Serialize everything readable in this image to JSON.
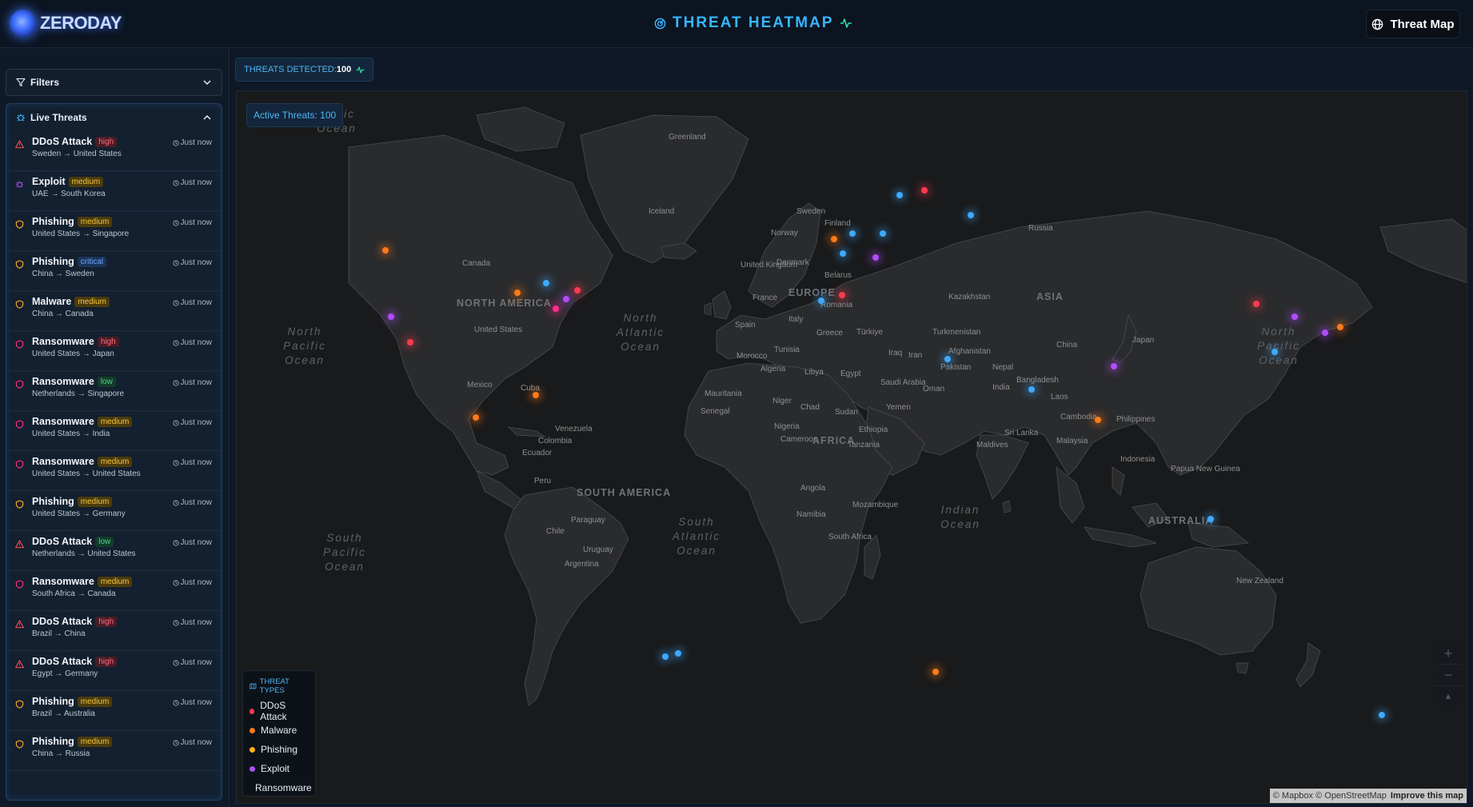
{
  "header": {
    "logo_text": "ZERODAY",
    "title": "THREAT HEATMAP",
    "threat_map_button": "Threat Map"
  },
  "sidebar": {
    "filters_label": "Filters",
    "live_threats_label": "Live Threats",
    "threats": [
      {
        "type": "DDoS Attack",
        "severity": "high",
        "route": "Sweden → United States",
        "time": "Just now",
        "icon": "warning-triangle-icon"
      },
      {
        "type": "Exploit",
        "severity": "medium",
        "route": "UAE → South Korea",
        "time": "Just now",
        "icon": "bug-icon"
      },
      {
        "type": "Phishing",
        "severity": "medium",
        "route": "United States → Singapore",
        "time": "Just now",
        "icon": "shield-icon"
      },
      {
        "type": "Phishing",
        "severity": "critical",
        "route": "China → Sweden",
        "time": "Just now",
        "icon": "shield-icon"
      },
      {
        "type": "Malware",
        "severity": "medium",
        "route": "China → Canada",
        "time": "Just now",
        "icon": "shield-icon"
      },
      {
        "type": "Ransomware",
        "severity": "high",
        "route": "United States → Japan",
        "time": "Just now",
        "icon": "shield-icon"
      },
      {
        "type": "Ransomware",
        "severity": "low",
        "route": "Netherlands → Singapore",
        "time": "Just now",
        "icon": "shield-icon"
      },
      {
        "type": "Ransomware",
        "severity": "medium",
        "route": "United States → India",
        "time": "Just now",
        "icon": "shield-icon"
      },
      {
        "type": "Ransomware",
        "severity": "medium",
        "route": "United States → United States",
        "time": "Just now",
        "icon": "shield-icon"
      },
      {
        "type": "Phishing",
        "severity": "medium",
        "route": "United States → Germany",
        "time": "Just now",
        "icon": "shield-icon"
      },
      {
        "type": "DDoS Attack",
        "severity": "low",
        "route": "Netherlands → United States",
        "time": "Just now",
        "icon": "warning-triangle-icon"
      },
      {
        "type": "Ransomware",
        "severity": "medium",
        "route": "South Africa → Canada",
        "time": "Just now",
        "icon": "shield-icon"
      },
      {
        "type": "DDoS Attack",
        "severity": "high",
        "route": "Brazil → China",
        "time": "Just now",
        "icon": "warning-triangle-icon"
      },
      {
        "type": "DDoS Attack",
        "severity": "high",
        "route": "Egypt → Germany",
        "time": "Just now",
        "icon": "warning-triangle-icon"
      },
      {
        "type": "Phishing",
        "severity": "medium",
        "route": "Brazil → Australia",
        "time": "Just now",
        "icon": "shield-icon"
      },
      {
        "type": "Phishing",
        "severity": "medium",
        "route": "China → Russia",
        "time": "Just now",
        "icon": "shield-icon"
      }
    ]
  },
  "main": {
    "threats_detected_label": "THREATS DETECTED:",
    "threats_detected_count": "100",
    "active_threats": "Active Threats: 100",
    "legend_title": "THREAT TYPES",
    "legend": [
      {
        "label": "DDoS Attack",
        "color": "#ff3b4e"
      },
      {
        "label": "Malware",
        "color": "#ff7a1a"
      },
      {
        "label": "Phishing",
        "color": "#ffb020"
      },
      {
        "label": "Exploit",
        "color": "#b14dff"
      },
      {
        "label": "Ransomware",
        "color": "#ff2d8f"
      }
    ],
    "zoom_in": "+",
    "zoom_out": "−",
    "compass": "▲",
    "attribution": "© Mapbox © OpenStreetMap",
    "improve_link": "Improve this map"
  },
  "map_labels": {
    "greenland": "Greenland",
    "iceland": "Iceland",
    "sweden": "Sweden",
    "finland": "Finland",
    "norway": "Norway",
    "russia": "Russia",
    "canada": "Canada",
    "united_kingdom": "United Kingdom",
    "denmark": "Denmark",
    "belarus": "Belarus",
    "europe": "EUROPE",
    "france": "France",
    "romania": "Romania",
    "spain": "Spain",
    "italy": "Italy",
    "greece": "Greece",
    "turkiye": "Türkiye",
    "kazakhstan": "Kazakhstan",
    "asia": "ASIA",
    "north_america": "NORTH AMERICA",
    "united_states": "United States",
    "turkmenistan": "Turkmenistan",
    "china": "China",
    "japan": "Japan",
    "tunisia": "Tunisia",
    "morocco": "Morocco",
    "algeria": "Algeria",
    "libya": "Libya",
    "egypt": "Egypt",
    "iraq": "Iraq",
    "iran": "Iran",
    "afghanistan": "Afghanistan",
    "pakistan": "Pakistan",
    "nepal": "Nepal",
    "bangladesh": "Bangladesh",
    "india": "India",
    "saudi_arabia": "Saudi Arabia",
    "oman": "Oman",
    "yemen": "Yemen",
    "mexico": "Mexico",
    "cuba": "Cuba",
    "mauritania": "Mauritania",
    "niger": "Niger",
    "chad": "Chad",
    "sudan": "Sudan",
    "senegal": "Senegal",
    "nigeria": "Nigeria",
    "ethiopia": "Ethiopia",
    "laos": "Laos",
    "philippines": "Philippines",
    "cambodia": "Cambodia",
    "venezuela": "Venezuela",
    "colombia": "Colombia",
    "ecuador": "Ecuador",
    "cameroon": "Cameroon",
    "africa": "AFRICA",
    "sri_lanka": "Sri Lanka",
    "maldives": "Maldives",
    "malaysia": "Malaysia",
    "indonesia": "Indonesia",
    "papua_new_guinea": "Papua New Guinea",
    "south_america": "SOUTH AMERICA",
    "peru": "Peru",
    "tanzania": "Tanzania",
    "angola": "Angola",
    "mozambique": "Mozambique",
    "paraguay": "Paraguay",
    "chile": "Chile",
    "namibia": "Namibia",
    "uruguay": "Uruguay",
    "south_africa": "South Africa",
    "argentina": "Argentina",
    "australia": "AUSTRALIA",
    "new_zealand": "New Zealand",
    "north_pacific": "North Pacific Ocean",
    "north_atlantic": "North Atlantic Ocean",
    "south_pacific": "South Pacific Ocean",
    "south_atlantic": "South Atlantic Ocean",
    "indian_ocean": "Indian Ocean",
    "arctic": "Arctic Ocean",
    "north_pacific_right": "North Pacific Ocean"
  },
  "threat_points": [
    {
      "lat": 49.5,
      "lon": -124,
      "type": "Malware"
    },
    {
      "lat": 37.5,
      "lon": -122.5,
      "type": "Exploit"
    },
    {
      "lat": 33,
      "lon": -117,
      "type": "DDoS Attack"
    },
    {
      "lat": 19.5,
      "lon": -99,
      "type": "Malware"
    },
    {
      "lat": 41.8,
      "lon": -87.6,
      "type": "Malware"
    },
    {
      "lat": 43.5,
      "lon": -79.5,
      "type": "Phishing"
    },
    {
      "lat": 38.9,
      "lon": -77,
      "type": "Ransomware"
    },
    {
      "lat": 40.7,
      "lon": -74,
      "type": "Exploit"
    },
    {
      "lat": 42.3,
      "lon": -71,
      "type": "DDoS Attack"
    },
    {
      "lat": 23.5,
      "lon": -82.5,
      "type": "Malware"
    },
    {
      "lat": -22.9,
      "lon": -43.2,
      "type": "Phishing"
    },
    {
      "lat": -23.5,
      "lon": -46.6,
      "type": "Phishing"
    },
    {
      "lat": 51.5,
      "lon": -0.1,
      "type": "Malware"
    },
    {
      "lat": 52.4,
      "lon": 4.9,
      "type": "Phishing"
    },
    {
      "lat": 52.5,
      "lon": 13.4,
      "type": "Phishing"
    },
    {
      "lat": 48.8,
      "lon": 2.4,
      "type": "Phishing"
    },
    {
      "lat": 48.2,
      "lon": 11.5,
      "type": "Exploit"
    },
    {
      "lat": 40.4,
      "lon": -3.7,
      "type": "Phishing"
    },
    {
      "lat": 41.4,
      "lon": 2.2,
      "type": "DDoS Attack"
    },
    {
      "lat": 59.3,
      "lon": 18.1,
      "type": "Phishing"
    },
    {
      "lat": 60.2,
      "lon": 24.9,
      "type": "DDoS Attack"
    },
    {
      "lat": 55.8,
      "lon": 37.6,
      "type": "Phishing"
    },
    {
      "lat": 30.0,
      "lon": 31.2,
      "type": "Phishing"
    },
    {
      "lat": 24.5,
      "lon": 54.4,
      "type": "Phishing"
    },
    {
      "lat": 19.0,
      "lon": 72.8,
      "type": "Malware"
    },
    {
      "lat": 28.6,
      "lon": 77.2,
      "type": "Exploit"
    },
    {
      "lat": 39.9,
      "lon": 116.4,
      "type": "DDoS Attack"
    },
    {
      "lat": 37.5,
      "lon": 127,
      "type": "Exploit"
    },
    {
      "lat": 31.2,
      "lon": 121.5,
      "type": "Phishing"
    },
    {
      "lat": 35.7,
      "lon": 139.7,
      "type": "Malware"
    },
    {
      "lat": 34.7,
      "lon": 135.5,
      "type": "Exploit"
    },
    {
      "lat": 1.3,
      "lon": 103.8,
      "type": "Phishing"
    },
    {
      "lat": -26.2,
      "lon": 28,
      "type": "Malware"
    },
    {
      "lat": -33.9,
      "lon": 151.2,
      "type": "Phishing"
    }
  ]
}
